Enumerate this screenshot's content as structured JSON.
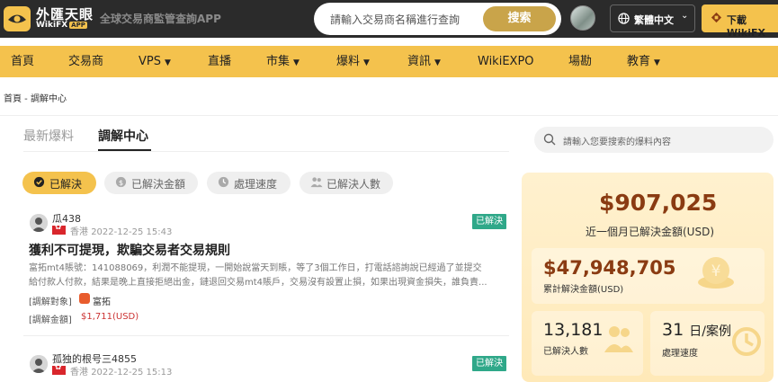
{
  "header": {
    "brand_cn": "外匯天眼",
    "brand_en": "WikiFX",
    "brand_app": "APP",
    "tagline": "全球交易商監管查詢APP",
    "search_placeholder": "請輸入交易商名稱進行查詢",
    "search_button": "搜索",
    "language": "繁體中文",
    "download": "下載WikiFX"
  },
  "nav": {
    "items": [
      {
        "label": "首頁"
      },
      {
        "label": "交易商"
      },
      {
        "label": "VPS"
      },
      {
        "label": "直播"
      },
      {
        "label": "市集"
      },
      {
        "label": "爆料"
      },
      {
        "label": "資訊"
      },
      {
        "label": "WikiEXPO"
      },
      {
        "label": "場勘"
      },
      {
        "label": "教育"
      }
    ]
  },
  "breadcrumb": "首頁 - 調解中心",
  "tabs": {
    "inactive": "最新爆料",
    "active": "調解中心"
  },
  "side_search": {
    "placeholder": "請輸入您要搜索的爆料內容"
  },
  "filters": [
    {
      "label": "已解決"
    },
    {
      "label": "已解決金額"
    },
    {
      "label": "處理速度"
    },
    {
      "label": "已解決人數"
    }
  ],
  "cards": [
    {
      "user": "瓜438",
      "region": "香港",
      "date": "2022-12-25 15:43",
      "status": "已解決",
      "title": "獲利不可提現，欺騙交易者交易規則",
      "desc_line1": "富拓mt4賬號：141088069，利潤不能提現，一開始說當天到賬，等了3個工作日，打電話諮詢說已經過了並提交",
      "desc_line2": "給付款人付款，結果是晚上直接拒絕出金，鏈退回交易mt4賬戶，交易沒有設置止損，如果出現資金損失，誰負責...",
      "target_label": "[調解對象]",
      "broker": "富拓",
      "amount_label": "[調解金額]",
      "amount": "$1,711(USD)"
    },
    {
      "user": "孤独的根号三4855",
      "region": "香港",
      "date": "2022-12-25 15:13",
      "status": "已解決"
    }
  ],
  "stats": {
    "month_amount": "$907,025",
    "month_label": "近一個月已解決金額(USD)",
    "total_amount": "$47,948,705",
    "total_label": "累計解決金額(USD)",
    "people": "13,181",
    "people_label": "已解決人數",
    "speed": "31",
    "speed_unit": "日/案例",
    "speed_label": "處理速度"
  }
}
